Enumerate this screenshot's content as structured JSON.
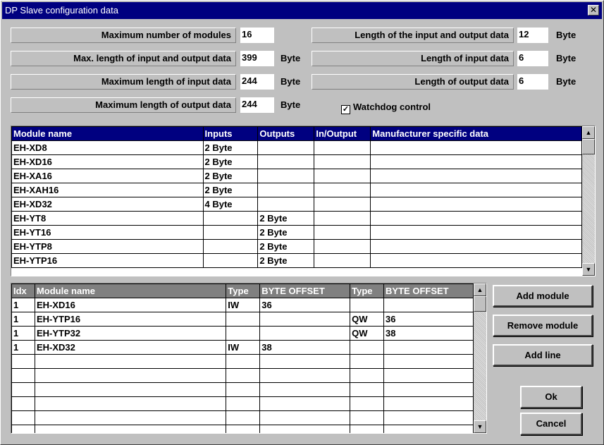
{
  "title": "DP Slave configuration data",
  "close_glyph": "✕",
  "fields_left": [
    {
      "label": "Maximum number of modules",
      "value": "16",
      "unit": ""
    },
    {
      "label": "Max. length of input and output data",
      "value": "399",
      "unit": "Byte"
    },
    {
      "label": "Maximum length of input data",
      "value": "244",
      "unit": "Byte"
    },
    {
      "label": "Maximum length of output data",
      "value": "244",
      "unit": "Byte"
    }
  ],
  "fields_right": [
    {
      "label": "Length of the input and output data",
      "value": "12",
      "unit": "Byte"
    },
    {
      "label": "Length of input data",
      "value": "6",
      "unit": "Byte"
    },
    {
      "label": "Length of output data",
      "value": "6",
      "unit": "Byte"
    }
  ],
  "watchdog": {
    "label": "Watchdog control",
    "checked": "✓"
  },
  "modules_table": {
    "headers": [
      "Module name",
      "Inputs",
      "Outputs",
      "In/Output",
      "Manufacturer specific data"
    ],
    "rows": [
      [
        "EH-XD8",
        "2 Byte",
        "",
        "",
        ""
      ],
      [
        "EH-XD16",
        "2 Byte",
        "",
        "",
        ""
      ],
      [
        "EH-XA16",
        "2 Byte",
        "",
        "",
        ""
      ],
      [
        "EH-XAH16",
        "2 Byte",
        "",
        "",
        ""
      ],
      [
        "EH-XD32",
        "4 Byte",
        "",
        "",
        ""
      ],
      [
        "EH-YT8",
        "",
        "2 Byte",
        "",
        ""
      ],
      [
        "EH-YT16",
        "",
        "2 Byte",
        "",
        ""
      ],
      [
        "EH-YTP8",
        "",
        "2 Byte",
        "",
        ""
      ],
      [
        "EH-YTP16",
        "",
        "2 Byte",
        "",
        ""
      ]
    ]
  },
  "config_table": {
    "headers": [
      "Idx",
      "Module name",
      "Type",
      "BYTE OFFSET",
      "Type",
      "BYTE OFFSET"
    ],
    "rows": [
      [
        "1",
        "EH-XD16",
        "IW",
        "36",
        "",
        ""
      ],
      [
        "1",
        "EH-YTP16",
        "",
        "",
        "QW",
        "36"
      ],
      [
        "1",
        "EH-YTP32",
        "",
        "",
        "QW",
        "38"
      ],
      [
        "1",
        "EH-XD32",
        "IW",
        "38",
        "",
        ""
      ],
      [
        "",
        "",
        "",
        "",
        "",
        ""
      ],
      [
        "",
        "",
        "",
        "",
        "",
        ""
      ],
      [
        "",
        "",
        "",
        "",
        "",
        ""
      ],
      [
        "",
        "",
        "",
        "",
        "",
        ""
      ],
      [
        "",
        "",
        "",
        "",
        "",
        ""
      ],
      [
        "",
        "",
        "",
        "",
        "",
        ""
      ]
    ]
  },
  "buttons": {
    "add_module": "Add module",
    "remove_module": "Remove module",
    "add_line": "Add line",
    "ok": "Ok",
    "cancel": "Cancel"
  }
}
